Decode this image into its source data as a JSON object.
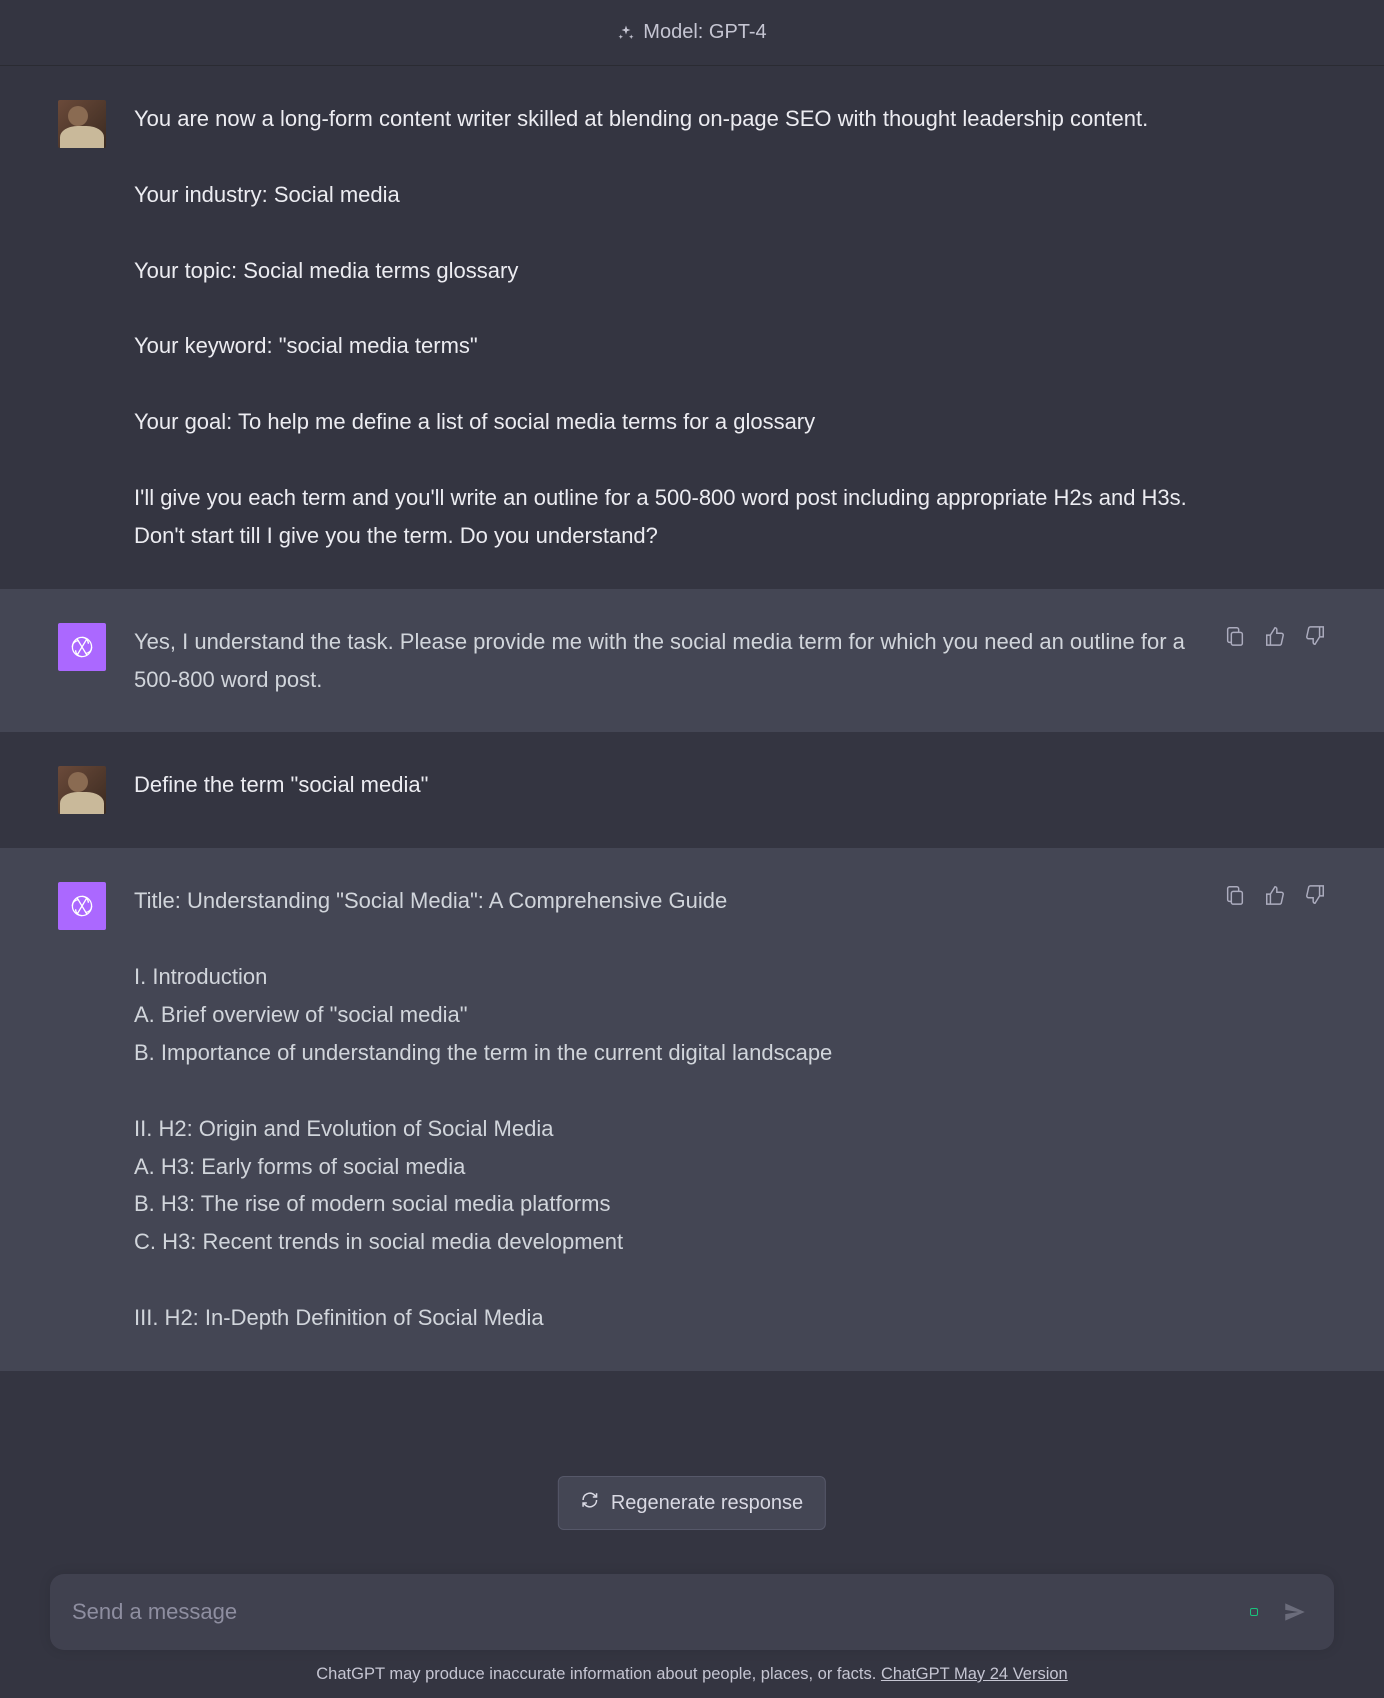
{
  "header": {
    "model_label": "Model: GPT-4"
  },
  "messages": [
    {
      "role": "user",
      "paragraphs": [
        "You are now a long-form content writer skilled at blending on-page SEO with thought leadership content.",
        "Your industry: Social media",
        "Your topic: Social media terms glossary",
        "Your keyword: \"social media terms\"",
        "Your goal: To help me define a list of social media terms for a glossary",
        "I'll give you each term and you'll write an outline for a 500-800 word post including appropriate H2s and H3s. Don't start till I give you the term. Do you understand?"
      ]
    },
    {
      "role": "assistant",
      "paragraphs": [
        "Yes, I understand the task. Please provide me with the social media term for which you need an outline for a 500-800 word post."
      ]
    },
    {
      "role": "user",
      "paragraphs": [
        "Define the term \"social media\""
      ]
    },
    {
      "role": "assistant",
      "paragraphs": [
        "Title: Understanding \"Social Media\": A Comprehensive Guide",
        "I. Introduction\nA. Brief overview of \"social media\"\nB. Importance of understanding the term in the current digital landscape",
        "II. H2: Origin and Evolution of Social Media\nA. H3: Early forms of social media\nB. H3: The rise of modern social media platforms\nC. H3: Recent trends in social media development",
        "III. H2: In-Depth Definition of Social Media"
      ]
    }
  ],
  "regenerate_label": "Regenerate response",
  "input": {
    "placeholder": "Send a message"
  },
  "footer": {
    "disclaimer_prefix": "ChatGPT may produce inaccurate information about people, places, or facts. ",
    "version_link": "ChatGPT May 24 Version"
  },
  "icons": {
    "sparkle": "sparkle-icon",
    "copy": "clipboard-icon",
    "thumbs_up": "thumbs-up-icon",
    "thumbs_down": "thumbs-down-icon",
    "refresh": "refresh-icon",
    "send": "send-icon",
    "openai": "openai-logo-icon"
  }
}
